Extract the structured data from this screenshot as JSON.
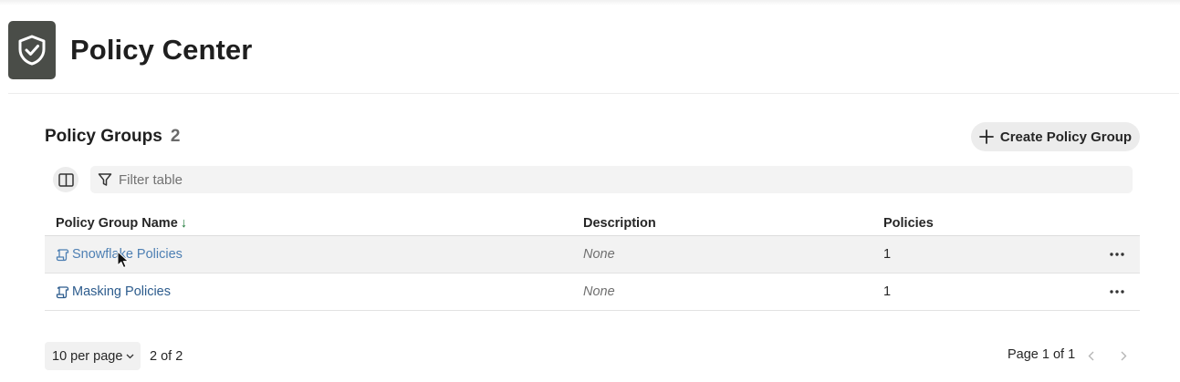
{
  "header": {
    "title": "Policy Center",
    "logo_icon": "shield-check-icon"
  },
  "section": {
    "title": "Policy Groups",
    "count": "2",
    "create_button_label": "Create Policy Group"
  },
  "toolbar": {
    "filter_placeholder": "Filter table",
    "columns_icon": "columns-icon",
    "filter_icon": "funnel-icon"
  },
  "table": {
    "columns": {
      "name": "Policy Group Name",
      "sort_indicator": "↓",
      "description": "Description",
      "policies": "Policies"
    },
    "rows": [
      {
        "name": "Snowflake Policies",
        "description": "None",
        "policies": "1",
        "hovered": true
      },
      {
        "name": "Masking Policies",
        "description": "None",
        "policies": "1",
        "hovered": false
      }
    ]
  },
  "pagination": {
    "per_page_label": "10 per page",
    "range_label": "2 of 2",
    "page_label": "Page 1 of 1"
  },
  "colors": {
    "logo_bg": "#4a4d48",
    "link": "#2d5c8d",
    "sort_arrow": "#1f7a3a"
  }
}
